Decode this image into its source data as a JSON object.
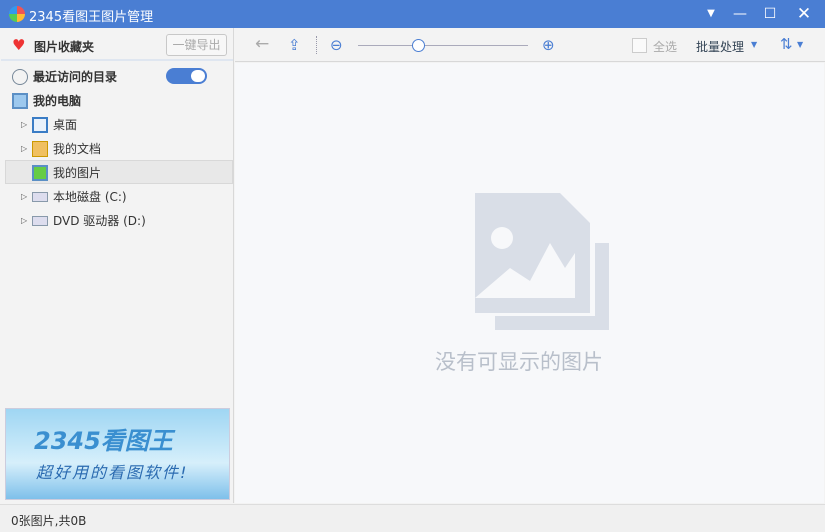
{
  "window": {
    "title": "2345看图王图片管理"
  },
  "sidebar": {
    "favorites_label": "图片收藏夹",
    "export_button": "一键导出",
    "recent_label": "最近访问的目录",
    "recent_toggle_on": true,
    "computer_label": "我的电脑",
    "items": [
      {
        "label": "桌面"
      },
      {
        "label": "我的文档"
      },
      {
        "label": "我的图片"
      },
      {
        "label": "本地磁盘 (C:)"
      },
      {
        "label": "DVD 驱动器 (D:)"
      }
    ],
    "ad": {
      "brand": "2345看图王",
      "slogan": "超好用的看图软件!"
    }
  },
  "toolbar": {
    "select_all": "全选",
    "batch": "批量处理",
    "zoom_level": 0.35
  },
  "main": {
    "empty_text": "没有可显示的图片"
  },
  "status": {
    "text": "0张图片,共0B"
  }
}
